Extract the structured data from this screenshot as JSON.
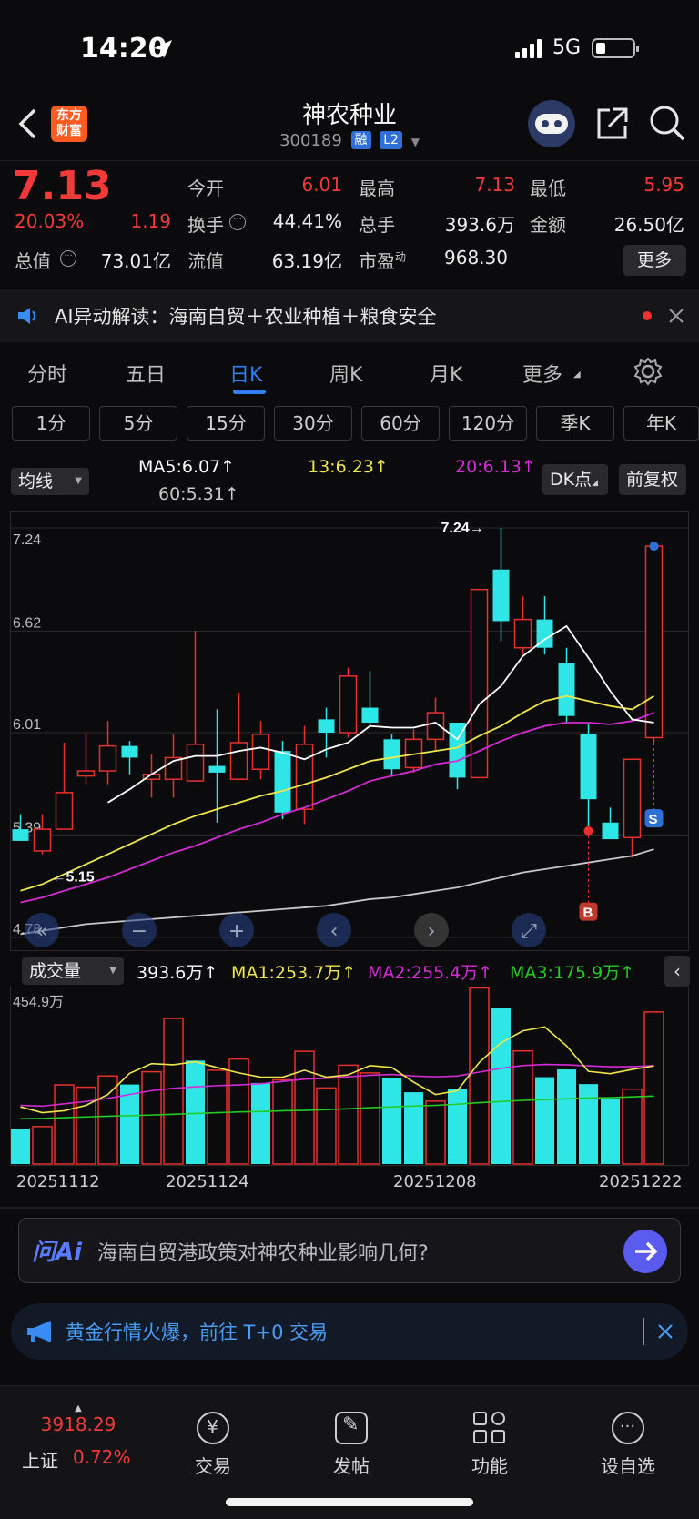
{
  "status_bar": {
    "time": "14:20",
    "network": "5G"
  },
  "header": {
    "logo_text": "东方财富",
    "stock_name": "神农种业",
    "stock_code": "300189",
    "tags": [
      "融",
      "L2"
    ]
  },
  "quote": {
    "price": "7.13",
    "change_pct": "20.03%",
    "change": "1.19",
    "fields": [
      {
        "label": "今开",
        "value": "6.01",
        "color": "#f23a3a"
      },
      {
        "label": "最高",
        "value": "7.13",
        "color": "#f23a3a"
      },
      {
        "label": "最低",
        "value": "5.95",
        "color": "#f23a3a"
      },
      {
        "label": "换手",
        "value": "44.41%",
        "color": "#ececec"
      },
      {
        "label": "总手",
        "value": "393.6万",
        "color": "#ececec"
      },
      {
        "label": "金额",
        "value": "26.50亿",
        "color": "#ececec"
      },
      {
        "label": "总值",
        "value": "73.01亿",
        "color": "#ececec"
      },
      {
        "label": "流值",
        "value": "63.19亿",
        "color": "#ececec"
      },
      {
        "label": "市盈",
        "value": "968.30",
        "color": "#ececec"
      }
    ],
    "pe_suffix": "动",
    "more_label": "更多"
  },
  "ai_bar": {
    "text": "AI异动解读：海南自贸＋农业种植＋粮食安全"
  },
  "period_tabs": [
    {
      "label": "分时",
      "active": false
    },
    {
      "label": "五日",
      "active": false
    },
    {
      "label": "日K",
      "active": true
    },
    {
      "label": "周K",
      "active": false
    },
    {
      "label": "月K",
      "active": false
    },
    {
      "label": "更多",
      "active": false
    }
  ],
  "minute_tabs": [
    "1分",
    "5分",
    "15分",
    "30分",
    "60分",
    "120分",
    "季K",
    "年K"
  ],
  "ma_legend": {
    "selector": "均线",
    "ma5": "MA5:6.07↑",
    "ma13": "13:6.23↑",
    "ma20": "20:6.13↑",
    "ma60": "60:5.31↑",
    "dk_label": "DK点",
    "adjust_label": "前复权"
  },
  "colors": {
    "up": "#e8302c",
    "down": "#2ee6e6",
    "ma5": "#ffffff",
    "ma13": "#f0e64a",
    "ma20": "#d42bd4",
    "ma60": "#c8c8c8",
    "vol_ma1": "#f0e64a",
    "vol_ma2": "#d42bd4",
    "vol_ma3": "#22cc22"
  },
  "chart_data": [
    {
      "type": "candlestick",
      "ylim": [
        4.78,
        7.24
      ],
      "y_ticks": [
        "7.24",
        "6.62",
        "6.01",
        "5.39",
        "4.78"
      ],
      "annotations": {
        "high_label": "7.24→",
        "low_label": "←5.15",
        "buy_marker": "B",
        "sell_marker": "S"
      },
      "candles": [
        {
          "o": 5.43,
          "c": 5.36,
          "h": 5.52,
          "l": 5.36
        },
        {
          "o": 5.3,
          "c": 5.43,
          "h": 5.52,
          "l": 5.28
        },
        {
          "o": 5.43,
          "c": 5.65,
          "h": 5.95,
          "l": 5.43
        },
        {
          "o": 5.75,
          "c": 5.78,
          "h": 6.0,
          "l": 5.7
        },
        {
          "o": 5.78,
          "c": 5.93,
          "h": 6.08,
          "l": 5.7
        },
        {
          "o": 5.93,
          "c": 5.86,
          "h": 5.96,
          "l": 5.76
        },
        {
          "o": 5.73,
          "c": 5.76,
          "h": 5.88,
          "l": 5.62
        },
        {
          "o": 5.73,
          "c": 5.86,
          "h": 6.0,
          "l": 5.62
        },
        {
          "o": 5.72,
          "c": 5.94,
          "h": 6.62,
          "l": 5.72
        },
        {
          "o": 5.81,
          "c": 5.77,
          "h": 6.15,
          "l": 5.47
        },
        {
          "o": 5.73,
          "c": 5.95,
          "h": 6.25,
          "l": 5.73
        },
        {
          "o": 5.79,
          "c": 6.0,
          "h": 6.08,
          "l": 5.73
        },
        {
          "o": 5.9,
          "c": 5.53,
          "h": 5.96,
          "l": 5.49
        },
        {
          "o": 5.55,
          "c": 5.94,
          "h": 6.05,
          "l": 5.46
        },
        {
          "o": 6.09,
          "c": 6.01,
          "h": 6.16,
          "l": 5.86
        },
        {
          "o": 6.01,
          "c": 6.35,
          "h": 6.4,
          "l": 5.98
        },
        {
          "o": 6.16,
          "c": 6.07,
          "h": 6.38,
          "l": 6.05
        },
        {
          "o": 5.97,
          "c": 5.79,
          "h": 6.0,
          "l": 5.75
        },
        {
          "o": 5.8,
          "c": 5.97,
          "h": 6.03,
          "l": 5.77
        },
        {
          "o": 5.97,
          "c": 6.13,
          "h": 6.22,
          "l": 5.9
        },
        {
          "o": 6.07,
          "c": 5.74,
          "h": 6.07,
          "l": 5.67
        },
        {
          "o": 5.74,
          "c": 6.87,
          "h": 6.87,
          "l": 5.74
        },
        {
          "o": 6.99,
          "c": 6.68,
          "h": 7.24,
          "l": 6.56
        },
        {
          "o": 6.52,
          "c": 6.69,
          "h": 6.83,
          "l": 6.48
        },
        {
          "o": 6.69,
          "c": 6.52,
          "h": 6.83,
          "l": 6.48
        },
        {
          "o": 6.43,
          "c": 6.11,
          "h": 6.52,
          "l": 6.06
        },
        {
          "o": 6.0,
          "c": 5.61,
          "h": 6.06,
          "l": 5.42
        },
        {
          "o": 5.47,
          "c": 5.37,
          "h": 5.56,
          "l": 5.37
        },
        {
          "o": 5.38,
          "c": 5.85,
          "h": 5.85,
          "l": 5.26
        },
        {
          "o": 5.98,
          "c": 7.13,
          "h": 7.13,
          "l": 5.95
        }
      ],
      "ma5": [
        null,
        null,
        null,
        null,
        5.59,
        5.67,
        5.76,
        5.84,
        5.87,
        5.87,
        5.9,
        5.92,
        5.89,
        5.85,
        5.91,
        5.95,
        6.05,
        6.04,
        6.04,
        6.07,
        5.97,
        6.18,
        6.29,
        6.47,
        6.57,
        6.65,
        6.46,
        6.26,
        6.09,
        6.07
      ],
      "ma13": [
        5.06,
        5.1,
        5.16,
        5.22,
        5.28,
        5.34,
        5.4,
        5.46,
        5.51,
        5.55,
        5.59,
        5.63,
        5.66,
        5.7,
        5.74,
        5.79,
        5.84,
        5.86,
        5.88,
        5.9,
        5.92,
        5.99,
        6.05,
        6.13,
        6.2,
        6.23,
        6.2,
        6.17,
        6.15,
        6.23
      ],
      "ma20": [
        4.99,
        5.02,
        5.06,
        5.1,
        5.14,
        5.19,
        5.24,
        5.29,
        5.33,
        5.38,
        5.43,
        5.47,
        5.52,
        5.56,
        5.61,
        5.66,
        5.72,
        5.75,
        5.78,
        5.82,
        5.84,
        5.9,
        5.96,
        6.01,
        6.05,
        6.07,
        6.07,
        6.06,
        6.08,
        6.13
      ],
      "ma60": [
        4.8,
        4.82,
        4.84,
        4.86,
        4.87,
        4.88,
        4.89,
        4.9,
        4.91,
        4.92,
        4.93,
        4.94,
        4.95,
        4.96,
        4.97,
        4.99,
        5.01,
        5.02,
        5.04,
        5.06,
        5.08,
        5.11,
        5.14,
        5.17,
        5.19,
        5.21,
        5.23,
        5.25,
        5.27,
        5.31
      ]
    },
    {
      "type": "bar",
      "title": "成交量",
      "ylim": [
        0,
        454.9
      ],
      "y_max_label": "454.9万",
      "unit": "万",
      "legend": {
        "vol": "393.6万↑",
        "ma1": "MA1:253.7万↑",
        "ma2": "MA2:255.4万↑",
        "ma3": "MA3:175.9万↑"
      },
      "x_labels": [
        "20251112",
        "20251124",
        "20251208",
        "20251222"
      ],
      "values": [
        92,
        97,
        205,
        199,
        228,
        206,
        239,
        377,
        268,
        243,
        272,
        210,
        218,
        292,
        197,
        256,
        236,
        224,
        186,
        163,
        194,
        456,
        403,
        293,
        225,
        245,
        207,
        170,
        194,
        394
      ],
      "up": [
        false,
        true,
        true,
        true,
        true,
        false,
        true,
        true,
        false,
        true,
        true,
        false,
        true,
        true,
        true,
        true,
        true,
        false,
        false,
        true,
        false,
        true,
        false,
        true,
        false,
        false,
        false,
        false,
        true,
        true
      ],
      "ma1": [
        148,
        133,
        138,
        152,
        180,
        235,
        260,
        257,
        265,
        250,
        236,
        225,
        225,
        243,
        225,
        231,
        255,
        250,
        212,
        180,
        190,
        263,
        314,
        345,
        355,
        306,
        240,
        234,
        245,
        254
      ],
      "ma2": [
        152,
        150,
        156,
        162,
        170,
        180,
        190,
        196,
        200,
        203,
        205,
        208,
        214,
        220,
        222,
        226,
        230,
        232,
        228,
        226,
        228,
        238,
        248,
        255,
        258,
        257,
        254,
        252,
        252,
        255
      ],
      "ma3": [
        117,
        118,
        120,
        122,
        124,
        125,
        127,
        129,
        131,
        133,
        135,
        136,
        138,
        139,
        141,
        143,
        146,
        148,
        150,
        152,
        155,
        159,
        162,
        165,
        167,
        169,
        171,
        172,
        174,
        176
      ]
    }
  ],
  "ai_question": {
    "logo": "问Ai",
    "text": "海南自贸港政策对神农种业影响几何?"
  },
  "gold_bar": {
    "text": "黄金行情火爆，前往 T+0 交易"
  },
  "bottom_nav": {
    "index_value": "3918.29",
    "index_name": "上证",
    "index_change": "0.72%",
    "items": [
      "交易",
      "发帖",
      "功能",
      "设自选"
    ]
  }
}
